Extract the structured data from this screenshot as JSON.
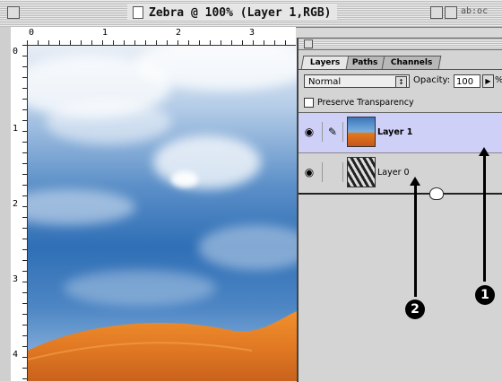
{
  "window": {
    "title": "Zebra @ 100% (Layer 1,RGB)",
    "background_window_text": "ab:oc"
  },
  "ruler": {
    "top_labels": [
      "0",
      "1",
      "2",
      "3"
    ],
    "left_labels": [
      "0",
      "1",
      "2",
      "3",
      "4"
    ]
  },
  "layers_palette": {
    "tabs": [
      {
        "label": "Layers",
        "active": true
      },
      {
        "label": "Paths",
        "active": false
      },
      {
        "label": "Channels",
        "active": false
      }
    ],
    "blend_mode": "Normal",
    "opacity_label": "Opacity:",
    "opacity_value": "100",
    "opacity_unit": "%",
    "preserve_transparency_label": "Preserve Transparency",
    "preserve_transparency_checked": false,
    "layers": [
      {
        "name": "Layer 1",
        "selected": true,
        "visible": true,
        "thumbnail": "sky-sand"
      },
      {
        "name": "Layer 0",
        "selected": false,
        "visible": true,
        "thumbnail": "zebra"
      }
    ]
  },
  "callouts": [
    {
      "number": "1",
      "target": "layer-1-row"
    },
    {
      "number": "2",
      "target": "layer-0-row"
    }
  ],
  "icons": {
    "eye": "eye-icon",
    "brush": "paintbrush-icon"
  },
  "colors": {
    "selected_layer": "#cfd0f7",
    "sand": "#e27a24",
    "sky": "#2f6fb6"
  }
}
